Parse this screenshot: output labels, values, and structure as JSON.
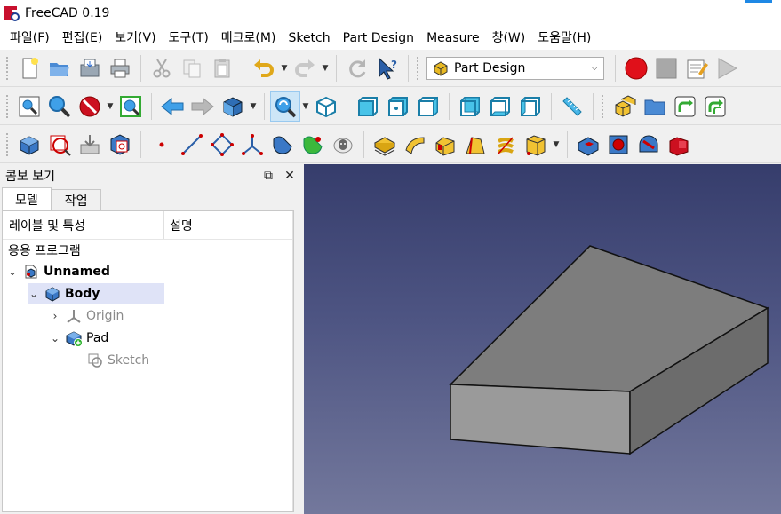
{
  "app": {
    "title": "FreeCAD 0.19"
  },
  "menu": [
    "파일(F)",
    "편집(E)",
    "보기(V)",
    "도구(T)",
    "매크로(M)",
    "Sketch",
    "Part Design",
    "Measure",
    "창(W)",
    "도움말(H)"
  ],
  "workbench": {
    "selected": "Part Design"
  },
  "combo_view": {
    "title": "콤보 보기",
    "tabs": [
      "모델",
      "작업"
    ],
    "active_tab": "모델",
    "columns": [
      "레이블 및 특성",
      "설명"
    ],
    "section": "응용 프로그램",
    "tree": [
      {
        "label": "Unnamed",
        "expander": "⌄",
        "icon": "document-icon"
      },
      {
        "label": "Body",
        "expander": "⌄",
        "icon": "body-icon"
      },
      {
        "label": "Origin",
        "expander": "›",
        "icon": "origin-icon"
      },
      {
        "label": "Pad",
        "expander": "⌄",
        "icon": "pad-icon"
      },
      {
        "label": "Sketch",
        "expander": "",
        "icon": "sketch-icon"
      }
    ]
  },
  "colors": {
    "viewport_top": "#363d6c",
    "viewport_bottom": "#73789c",
    "box_top": "#7d7d7d",
    "box_front": "#9a9a9a",
    "box_side": "#6c6c6c",
    "selection": "#dfe3f7",
    "record": "#e0101a"
  }
}
